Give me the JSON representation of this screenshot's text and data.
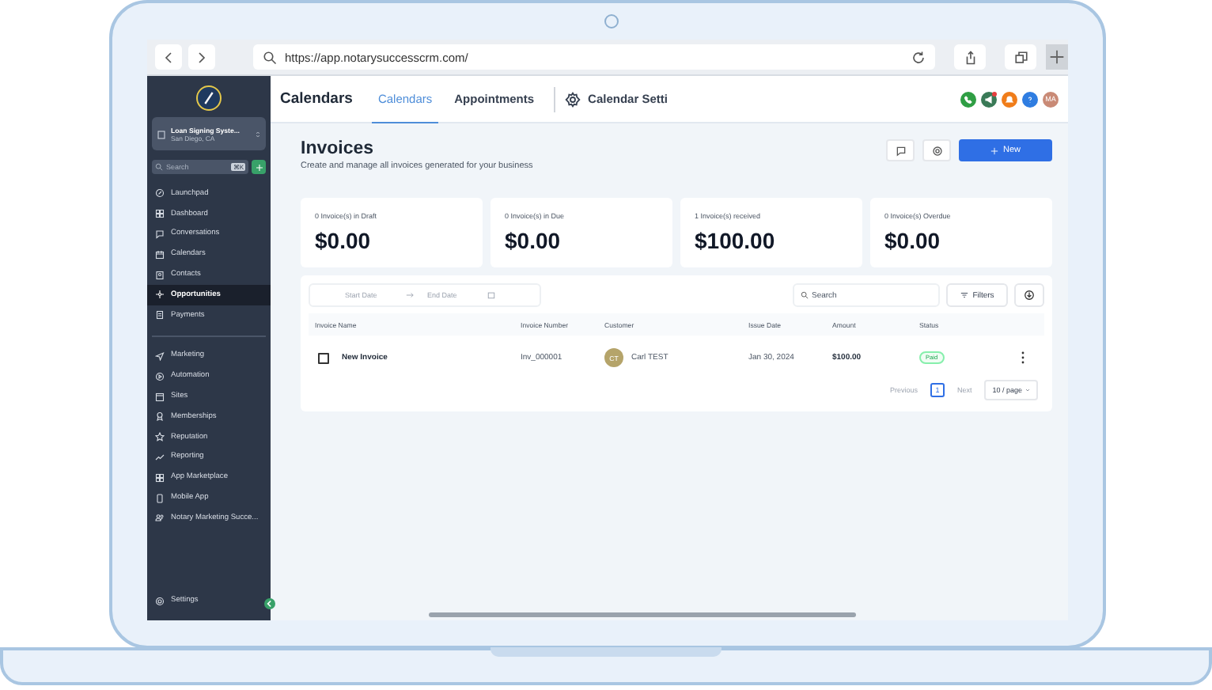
{
  "browser": {
    "url": "https://app.notarysuccesscrm.com/"
  },
  "sidebar": {
    "account": {
      "name": "Loan Signing Syste...",
      "location": "San Diego, CA"
    },
    "search": {
      "placeholder": "Search",
      "shortcut": "⌘K"
    },
    "items": [
      {
        "label": "Launchpad",
        "selected": false
      },
      {
        "label": "Dashboard",
        "selected": false
      },
      {
        "label": "Conversations",
        "selected": false
      },
      {
        "label": "Calendars",
        "selected": false
      },
      {
        "label": "Contacts",
        "selected": false
      },
      {
        "label": "Opportunities",
        "selected": true
      },
      {
        "label": "Payments",
        "selected": false
      }
    ],
    "items_2": [
      {
        "label": "Marketing",
        "selected": false
      },
      {
        "label": "Automation",
        "selected": false
      },
      {
        "label": "Sites",
        "selected": false
      },
      {
        "label": "Memberships",
        "selected": false
      },
      {
        "label": "Reputation",
        "selected": false
      },
      {
        "label": "Reporting",
        "selected": false
      },
      {
        "label": "App Marketplace",
        "selected": false
      },
      {
        "label": "Mobile App",
        "selected": false
      },
      {
        "label": "Notary Marketing Succe...",
        "selected": false
      }
    ],
    "settings": "Settings"
  },
  "topbar": {
    "title": "Calendars",
    "tabs": [
      {
        "label": "Calendars",
        "selected": true
      },
      {
        "label": "Appointments",
        "selected": false
      }
    ],
    "settings_link": "Calendar Setti",
    "avatar": "MA"
  },
  "page": {
    "title": "Invoices",
    "subtitle": "Create and manage all invoices generated for your business",
    "new_button": "New",
    "stats": [
      {
        "label": "0 Invoice(s) in Draft",
        "value": "$0.00"
      },
      {
        "label": "0 Invoice(s) in Due",
        "value": "$0.00"
      },
      {
        "label": "1 Invoice(s) received",
        "value": "$100.00"
      },
      {
        "label": "0 Invoice(s) Overdue",
        "value": "$0.00"
      }
    ],
    "filters": {
      "start_date": "Start Date",
      "end_date": "End Date",
      "search": {
        "placeholder": "Search"
      },
      "filters_button": "Filters"
    },
    "table": {
      "columns": [
        "Invoice Name",
        "Invoice Number",
        "Customer",
        "Issue Date",
        "Amount",
        "Status"
      ],
      "rows": [
        {
          "checked": false,
          "name": "New Invoice",
          "number": "Inv_000001",
          "initials": "CT",
          "customer": "Carl TEST",
          "issue_date": "Jan 30, 2024",
          "amount": "$100.00",
          "status": "Paid"
        }
      ]
    },
    "pagination": {
      "previous": "Previous",
      "pages": [
        {
          "label": "1",
          "selected": true
        }
      ],
      "next": "Next",
      "page_size": "10 / page"
    }
  }
}
